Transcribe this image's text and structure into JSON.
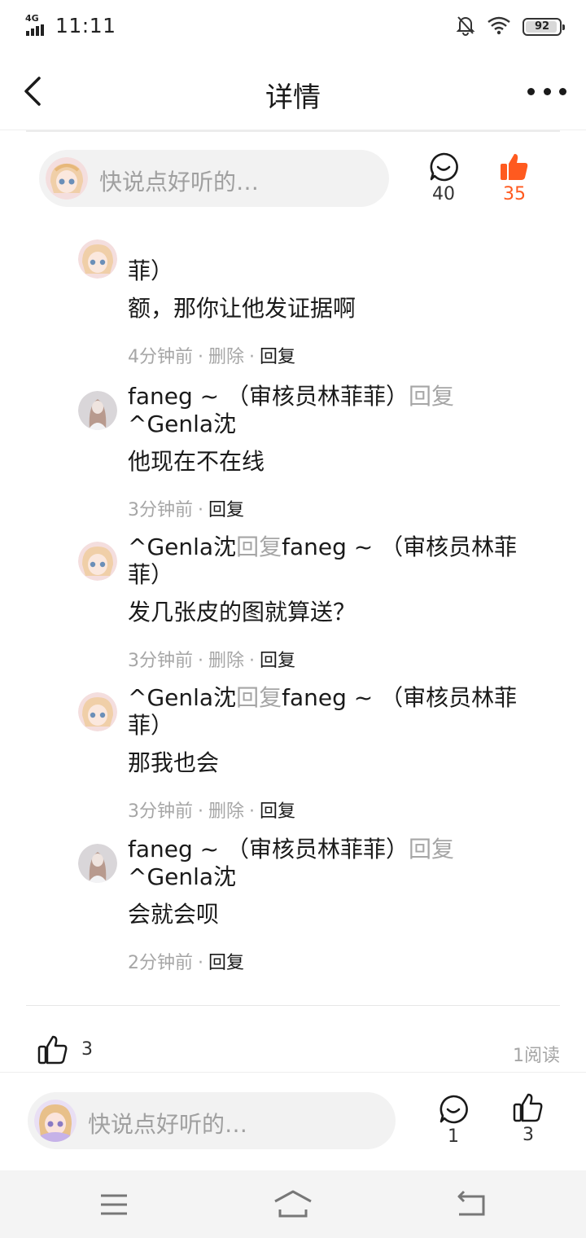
{
  "status_bar": {
    "network": "4G",
    "time": "11:11",
    "battery": "92"
  },
  "header": {
    "title": "详情"
  },
  "top_bar": {
    "placeholder": "快说点好听的…",
    "comment_count": "40",
    "like_count": "35",
    "like_color": "#ff5a1f"
  },
  "comments": [
    {
      "author": "",
      "reply_label": "",
      "target": "菲）",
      "text": "额，那你让他发证据啊",
      "time": "4分钟前",
      "delete_label": "删除",
      "reply_action": "回复"
    },
    {
      "author": "faneg ~ （审核员林菲菲）",
      "reply_label": "回复",
      "target": "^Genla沈",
      "text": "他现在不在线",
      "time": "3分钟前",
      "reply_action": "回复"
    },
    {
      "author": "^Genla沈",
      "reply_label": "回复",
      "target": "faneg ~ （审核员林菲菲）",
      "text": "发几张皮的图就算送？",
      "time": "3分钟前",
      "delete_label": "删除",
      "reply_action": "回复"
    },
    {
      "author": "^Genla沈",
      "reply_label": "回复",
      "target": "faneg ~ （审核员林菲菲）",
      "text": "那我也会",
      "time": "3分钟前",
      "delete_label": "删除",
      "reply_action": "回复"
    },
    {
      "author": "faneg ~ （审核员林菲菲）",
      "reply_label": "回复",
      "target": "^Genla沈",
      "text": "会就会呗",
      "time": "2分钟前",
      "reply_action": "回复"
    }
  ],
  "footer": {
    "like_count": "3",
    "reads": "1阅读"
  },
  "bottom_bar": {
    "placeholder": "快说点好听的…",
    "comment_count": "1",
    "like_count": "3"
  },
  "colors": {
    "accent": "#ff5a1f",
    "secondary_text": "#a6a6a6"
  }
}
